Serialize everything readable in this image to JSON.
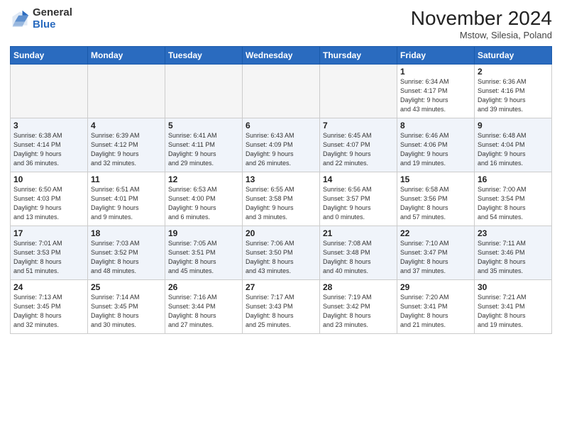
{
  "logo": {
    "general": "General",
    "blue": "Blue"
  },
  "title": "November 2024",
  "location": "Mstow, Silesia, Poland",
  "weekdays": [
    "Sunday",
    "Monday",
    "Tuesday",
    "Wednesday",
    "Thursday",
    "Friday",
    "Saturday"
  ],
  "weeks": [
    [
      {
        "day": "",
        "info": ""
      },
      {
        "day": "",
        "info": ""
      },
      {
        "day": "",
        "info": ""
      },
      {
        "day": "",
        "info": ""
      },
      {
        "day": "",
        "info": ""
      },
      {
        "day": "1",
        "info": "Sunrise: 6:34 AM\nSunset: 4:17 PM\nDaylight: 9 hours\nand 43 minutes."
      },
      {
        "day": "2",
        "info": "Sunrise: 6:36 AM\nSunset: 4:16 PM\nDaylight: 9 hours\nand 39 minutes."
      }
    ],
    [
      {
        "day": "3",
        "info": "Sunrise: 6:38 AM\nSunset: 4:14 PM\nDaylight: 9 hours\nand 36 minutes."
      },
      {
        "day": "4",
        "info": "Sunrise: 6:39 AM\nSunset: 4:12 PM\nDaylight: 9 hours\nand 32 minutes."
      },
      {
        "day": "5",
        "info": "Sunrise: 6:41 AM\nSunset: 4:11 PM\nDaylight: 9 hours\nand 29 minutes."
      },
      {
        "day": "6",
        "info": "Sunrise: 6:43 AM\nSunset: 4:09 PM\nDaylight: 9 hours\nand 26 minutes."
      },
      {
        "day": "7",
        "info": "Sunrise: 6:45 AM\nSunset: 4:07 PM\nDaylight: 9 hours\nand 22 minutes."
      },
      {
        "day": "8",
        "info": "Sunrise: 6:46 AM\nSunset: 4:06 PM\nDaylight: 9 hours\nand 19 minutes."
      },
      {
        "day": "9",
        "info": "Sunrise: 6:48 AM\nSunset: 4:04 PM\nDaylight: 9 hours\nand 16 minutes."
      }
    ],
    [
      {
        "day": "10",
        "info": "Sunrise: 6:50 AM\nSunset: 4:03 PM\nDaylight: 9 hours\nand 13 minutes."
      },
      {
        "day": "11",
        "info": "Sunrise: 6:51 AM\nSunset: 4:01 PM\nDaylight: 9 hours\nand 9 minutes."
      },
      {
        "day": "12",
        "info": "Sunrise: 6:53 AM\nSunset: 4:00 PM\nDaylight: 9 hours\nand 6 minutes."
      },
      {
        "day": "13",
        "info": "Sunrise: 6:55 AM\nSunset: 3:58 PM\nDaylight: 9 hours\nand 3 minutes."
      },
      {
        "day": "14",
        "info": "Sunrise: 6:56 AM\nSunset: 3:57 PM\nDaylight: 9 hours\nand 0 minutes."
      },
      {
        "day": "15",
        "info": "Sunrise: 6:58 AM\nSunset: 3:56 PM\nDaylight: 8 hours\nand 57 minutes."
      },
      {
        "day": "16",
        "info": "Sunrise: 7:00 AM\nSunset: 3:54 PM\nDaylight: 8 hours\nand 54 minutes."
      }
    ],
    [
      {
        "day": "17",
        "info": "Sunrise: 7:01 AM\nSunset: 3:53 PM\nDaylight: 8 hours\nand 51 minutes."
      },
      {
        "day": "18",
        "info": "Sunrise: 7:03 AM\nSunset: 3:52 PM\nDaylight: 8 hours\nand 48 minutes."
      },
      {
        "day": "19",
        "info": "Sunrise: 7:05 AM\nSunset: 3:51 PM\nDaylight: 8 hours\nand 45 minutes."
      },
      {
        "day": "20",
        "info": "Sunrise: 7:06 AM\nSunset: 3:50 PM\nDaylight: 8 hours\nand 43 minutes."
      },
      {
        "day": "21",
        "info": "Sunrise: 7:08 AM\nSunset: 3:48 PM\nDaylight: 8 hours\nand 40 minutes."
      },
      {
        "day": "22",
        "info": "Sunrise: 7:10 AM\nSunset: 3:47 PM\nDaylight: 8 hours\nand 37 minutes."
      },
      {
        "day": "23",
        "info": "Sunrise: 7:11 AM\nSunset: 3:46 PM\nDaylight: 8 hours\nand 35 minutes."
      }
    ],
    [
      {
        "day": "24",
        "info": "Sunrise: 7:13 AM\nSunset: 3:45 PM\nDaylight: 8 hours\nand 32 minutes."
      },
      {
        "day": "25",
        "info": "Sunrise: 7:14 AM\nSunset: 3:45 PM\nDaylight: 8 hours\nand 30 minutes."
      },
      {
        "day": "26",
        "info": "Sunrise: 7:16 AM\nSunset: 3:44 PM\nDaylight: 8 hours\nand 27 minutes."
      },
      {
        "day": "27",
        "info": "Sunrise: 7:17 AM\nSunset: 3:43 PM\nDaylight: 8 hours\nand 25 minutes."
      },
      {
        "day": "28",
        "info": "Sunrise: 7:19 AM\nSunset: 3:42 PM\nDaylight: 8 hours\nand 23 minutes."
      },
      {
        "day": "29",
        "info": "Sunrise: 7:20 AM\nSunset: 3:41 PM\nDaylight: 8 hours\nand 21 minutes."
      },
      {
        "day": "30",
        "info": "Sunrise: 7:21 AM\nSunset: 3:41 PM\nDaylight: 8 hours\nand 19 minutes."
      }
    ]
  ]
}
